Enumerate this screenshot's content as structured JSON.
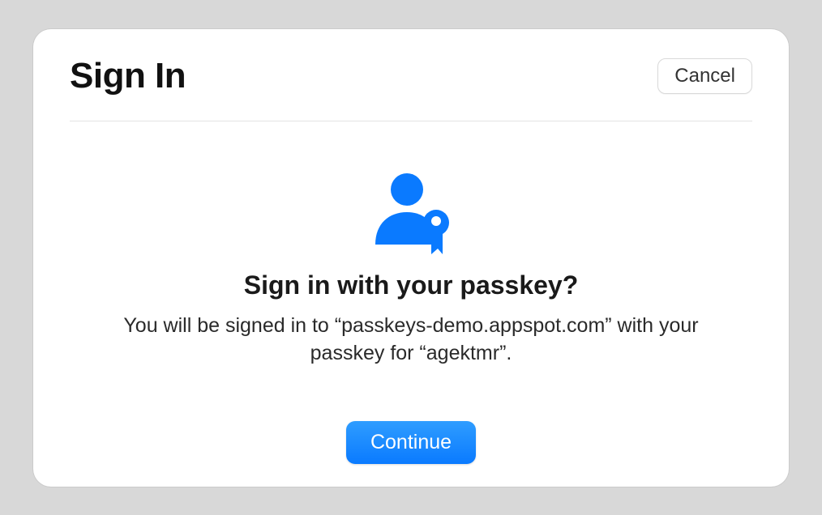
{
  "header": {
    "title": "Sign In",
    "cancel_label": "Cancel"
  },
  "content": {
    "prompt_title": "Sign in with your passkey?",
    "prompt_description": "You will be signed in to “passkeys-demo.appspot.com” with your passkey for “agektmr”.",
    "continue_label": "Continue"
  },
  "colors": {
    "accent": "#0a7aff",
    "icon": "#0a7aff"
  }
}
